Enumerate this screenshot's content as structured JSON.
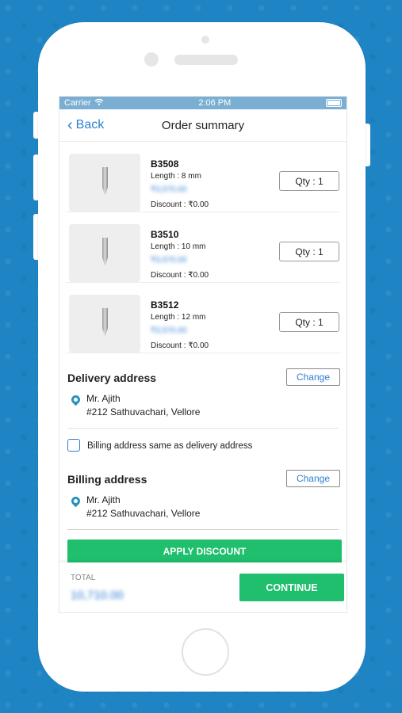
{
  "status_bar": {
    "carrier": "Carrier",
    "time": "2:06 PM",
    "wifi_icon": "wifi-icon",
    "battery_icon": "battery-icon"
  },
  "nav": {
    "back_label": "Back",
    "title": "Order summary"
  },
  "products": [
    {
      "code": "B3508",
      "length": "Length : 8 mm",
      "price": "₹3,570.00",
      "discount": "Discount : ₹0.00",
      "qty": "Qty : 1"
    },
    {
      "code": "B3510",
      "length": "Length : 10 mm",
      "price": "₹3,570.00",
      "discount": "Discount : ₹0.00",
      "qty": "Qty : 1"
    },
    {
      "code": "B3512",
      "length": "Length : 12 mm",
      "price": "₹3,570.00",
      "discount": "Discount : ₹0.00",
      "qty": "Qty : 1"
    }
  ],
  "delivery": {
    "title": "Delivery address",
    "change": "Change",
    "name": "Mr. Ajith",
    "address": "#212 Sathuvachari, Vellore"
  },
  "billing_same": "Billing address same as delivery address",
  "billing": {
    "title": "Billing address",
    "change": "Change",
    "name": "Mr. Ajith",
    "address": "#212 Sathuvachari, Vellore"
  },
  "apply_discount": "APPLY DISCOUNT",
  "footer": {
    "total_label": "TOTAL",
    "total_value": "10,710.00",
    "continue": "CONTINUE"
  },
  "colors": {
    "accent": "#2f7fd1",
    "primary_button": "#1fbf6d",
    "background": "#1f84c4"
  }
}
